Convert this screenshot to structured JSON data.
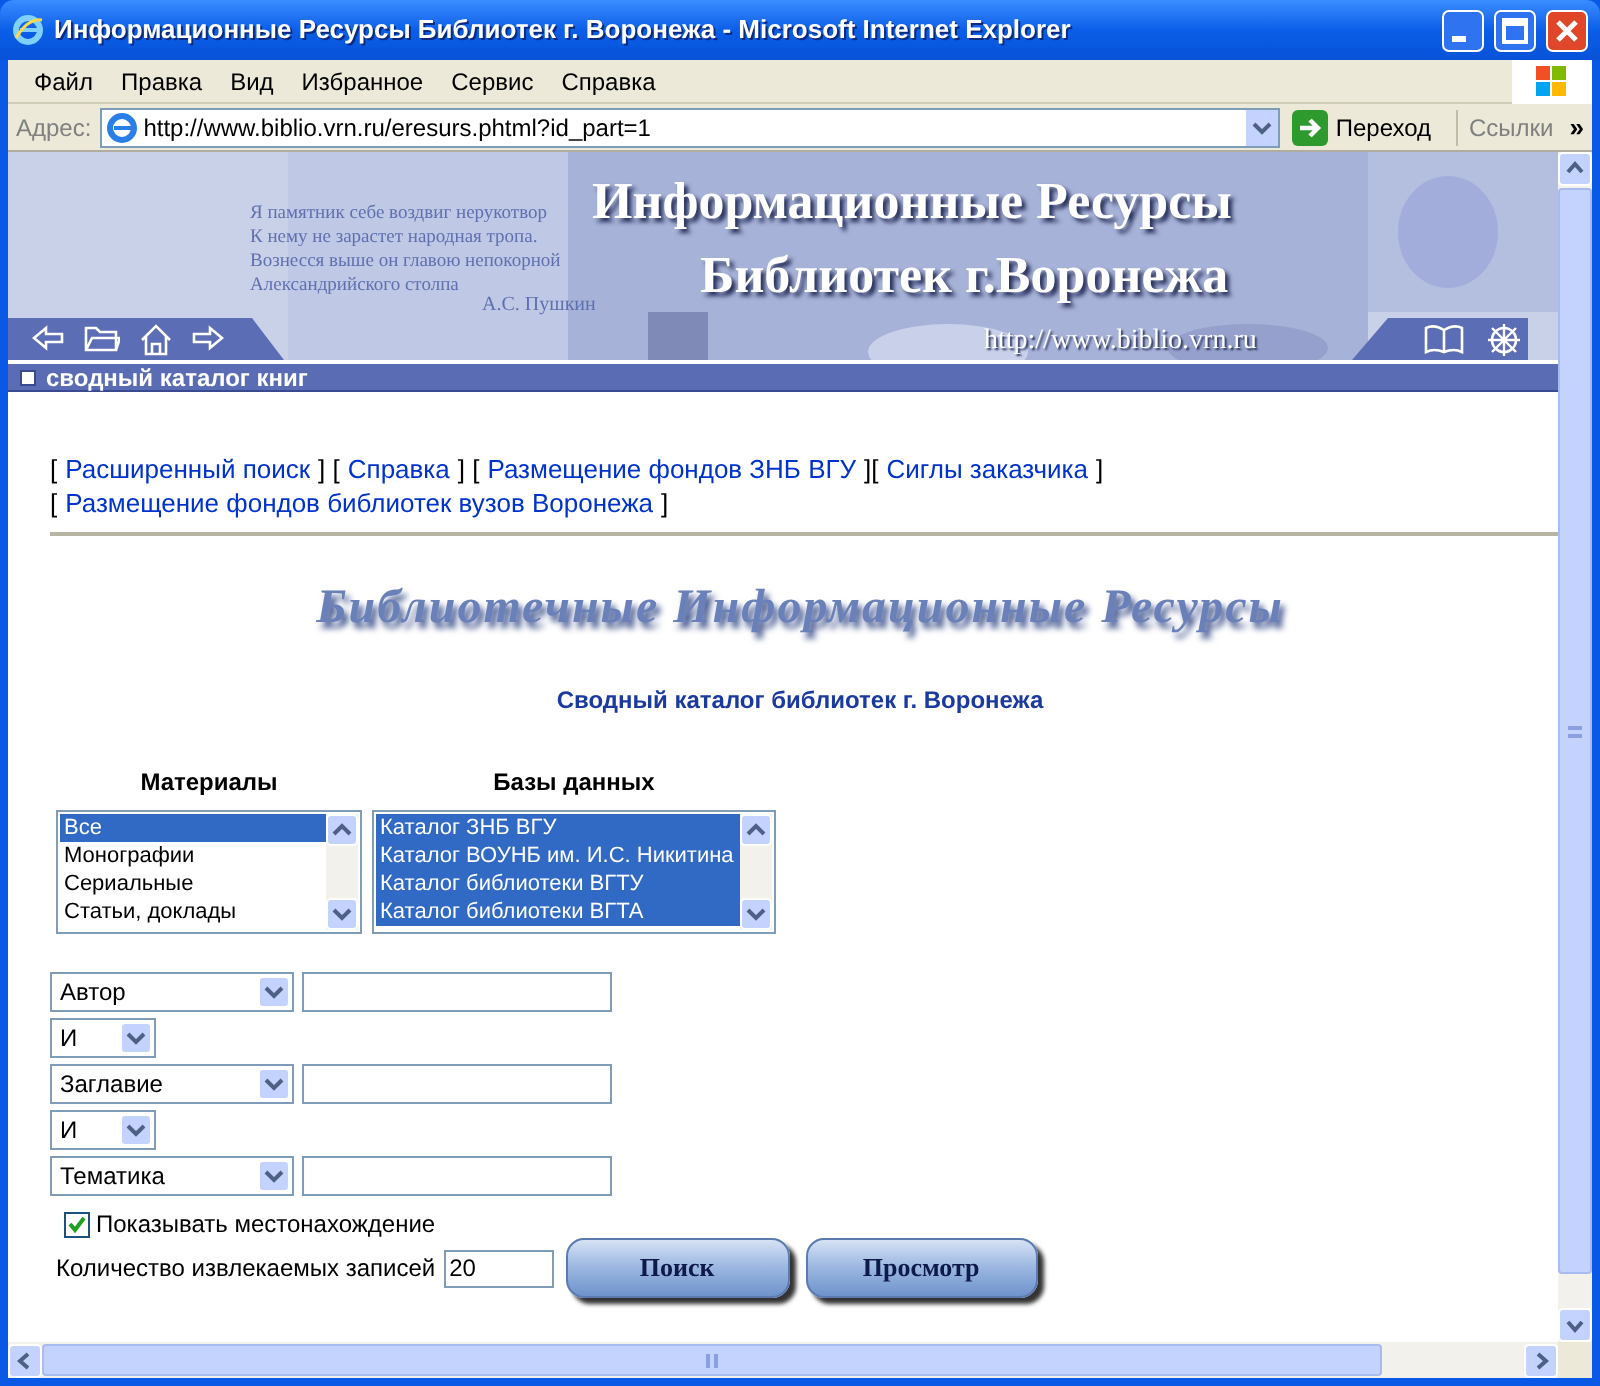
{
  "window": {
    "title": "Информационные Ресурсы Библиотек г. Воронежа - Microsoft Internet Explorer"
  },
  "menu": [
    "Файл",
    "Правка",
    "Вид",
    "Избранное",
    "Сервис",
    "Справка"
  ],
  "address_bar": {
    "label": "Адрес:",
    "url": "http://www.biblio.vrn.ru/eresurs.phtml?id_part=1",
    "go": "Переход",
    "links": "Ссылки",
    "more": "»"
  },
  "banner": {
    "title_lines": [
      "Информационные Ресурсы",
      "Библиотек г.Воронежа"
    ],
    "url": "http://www.biblio.vrn.ru",
    "quote": [
      "Я памятник себе воздвиг нерукотвор",
      "К нему не зарастет народная тропа.",
      "Вознесся выше он главою непокорной",
      "Александрийского столпа"
    ],
    "author": "А.С. Пушкин"
  },
  "section_bar": "сводный каталог книг",
  "nav_lines": [
    [
      {
        "kind": "text",
        "text": "["
      },
      {
        "kind": "link",
        "text": "Расширенный поиск"
      },
      {
        "kind": "text",
        "text": "] ["
      },
      {
        "kind": "link",
        "text": "Справка"
      },
      {
        "kind": "text",
        "text": "] ["
      },
      {
        "kind": "link",
        "text": "Размещение фондов ЗНБ ВГУ"
      },
      {
        "kind": "text",
        "text": "]["
      },
      {
        "kind": "link",
        "text": "Сиглы заказчика"
      },
      {
        "kind": "text",
        "text": "]"
      }
    ],
    [
      {
        "kind": "text",
        "text": "["
      },
      {
        "kind": "link",
        "text": "Размещение фондов библиотек вузов Воронежа"
      },
      {
        "kind": "text",
        "text": "]"
      }
    ]
  ],
  "heading": "Библиотечные Информационные Ресурсы",
  "subtitle": "Сводный каталог библиотек г. Воронежа",
  "lists": [
    {
      "label": "Материалы",
      "options": [
        {
          "text": "Все",
          "selected": true
        },
        {
          "text": "Монографии",
          "selected": false
        },
        {
          "text": "Сериальные",
          "selected": false
        },
        {
          "text": "Статьи, доклады",
          "selected": false
        }
      ]
    },
    {
      "label": "Базы данных",
      "options": [
        {
          "text": "Каталог ЗНБ ВГУ",
          "selected": true
        },
        {
          "text": "Каталог ВОУНБ им. И.С. Никитина",
          "selected": true
        },
        {
          "text": "Каталог библиотеки ВГТУ",
          "selected": true
        },
        {
          "text": "Каталог библиотеки ВГТА",
          "selected": true
        }
      ]
    }
  ],
  "search_rows": [
    {
      "kind": "field",
      "field": "Автор"
    },
    {
      "kind": "operator",
      "value": "И"
    },
    {
      "kind": "field",
      "field": "Заглавие"
    },
    {
      "kind": "operator",
      "value": "И"
    },
    {
      "kind": "field",
      "field": "Тематика"
    }
  ],
  "show_location": {
    "label": "Показывать местонахождение",
    "checked": true
  },
  "count": {
    "label": "Количество извлекаемых записей",
    "value": "20"
  },
  "buttons": [
    "Поиск",
    "Просмотр"
  ]
}
